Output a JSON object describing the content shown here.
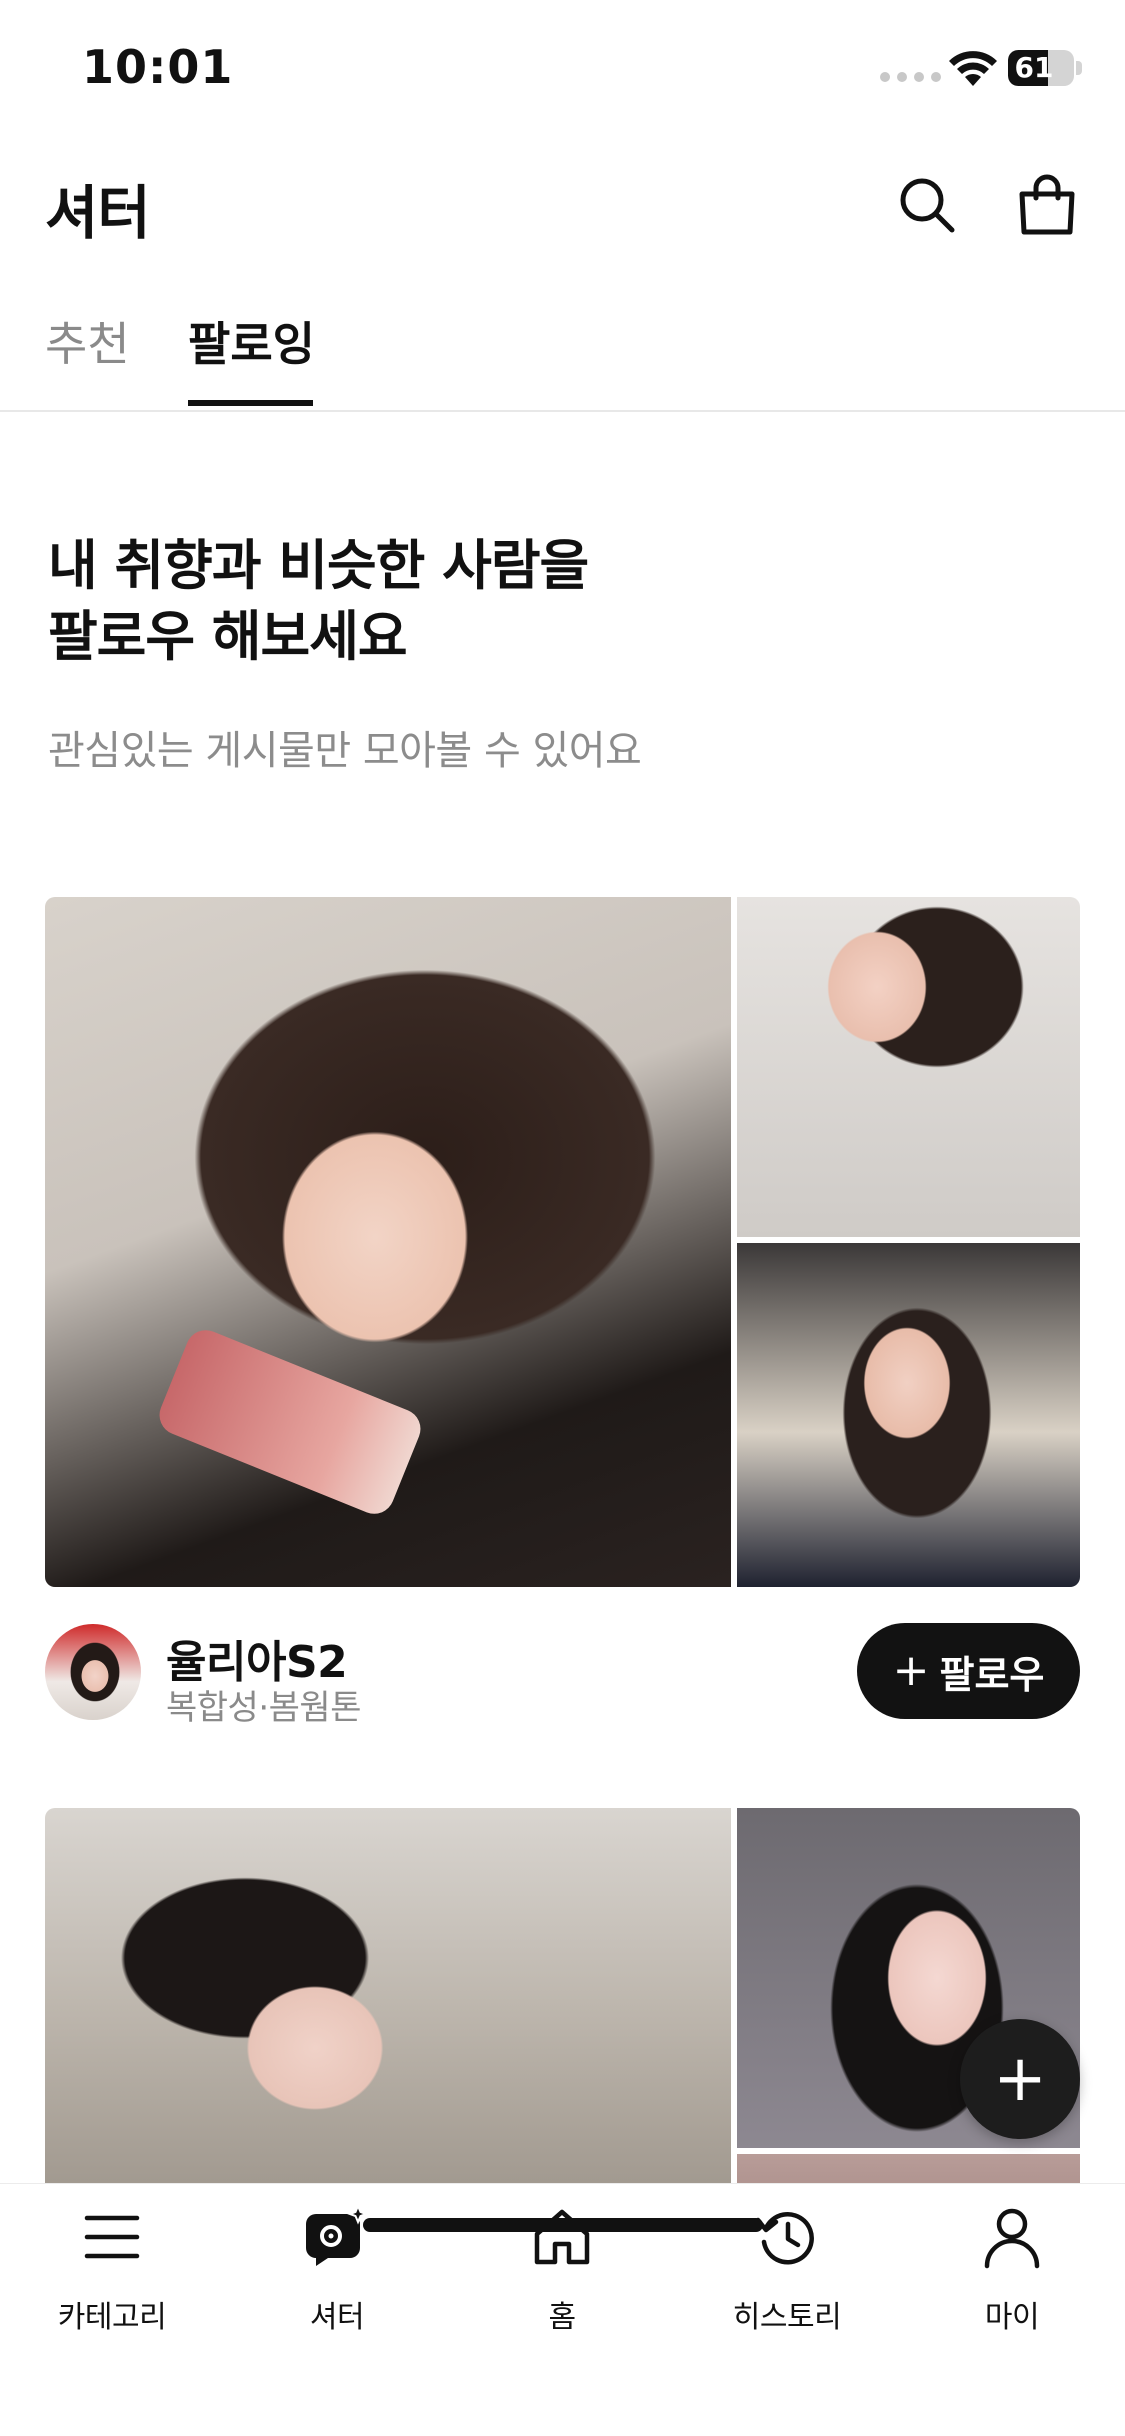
{
  "status_bar": {
    "time": "10:01",
    "battery": "61",
    "battery_percent": 61
  },
  "header": {
    "title": "셔터",
    "search_icon": "search-icon",
    "bag_icon": "shopping-bag-icon"
  },
  "tabs": [
    {
      "label": "추천",
      "active": false
    },
    {
      "label": "팔로잉",
      "active": true
    }
  ],
  "intro": {
    "title_line1": "내 취향과 비슷한 사람을",
    "title_line2": "팔로우 해보세요",
    "subtitle": "관심있는 게시물만 모아볼 수 있어요"
  },
  "profiles": [
    {
      "name": "율리아S2",
      "meta": "복합성·봄웜톤",
      "follow_label": "팔로우",
      "follow_icon": "+"
    }
  ],
  "fab": {
    "icon": "+"
  },
  "bottom_nav": [
    {
      "label": "카테고리",
      "icon": "menu-icon"
    },
    {
      "label": "셔터",
      "icon": "shutter-icon"
    },
    {
      "label": "홈",
      "icon": "home-icon"
    },
    {
      "label": "히스토리",
      "icon": "history-icon"
    },
    {
      "label": "마이",
      "icon": "user-icon"
    }
  ],
  "colors": {
    "primary_text": "#111111",
    "secondary_text": "#8a8a8a",
    "button_dark": "#121212"
  }
}
